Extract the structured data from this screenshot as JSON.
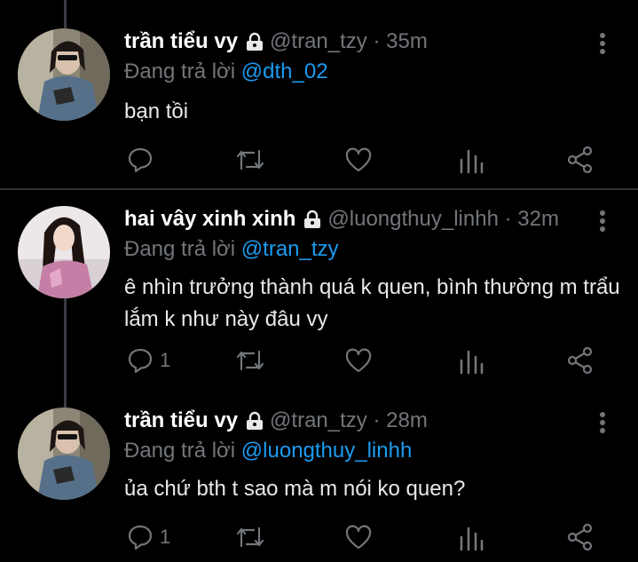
{
  "tweets": [
    {
      "name": "trần tiểu vy",
      "handle": "@tran_tzy",
      "sep": "·",
      "time": "35m",
      "reply_prefix": "Đang trả lời",
      "reply_to": "@dth_02",
      "text": "bạn tồi",
      "reply_count": ""
    },
    {
      "name": "hai vây xinh xinh",
      "handle": "@luongthuy_linhh",
      "sep": "·",
      "time": "32m",
      "reply_prefix": "Đang trả lời",
      "reply_to": "@tran_tzy",
      "text": "ê nhìn trưởng thành quá k quen, bình thường m trẩu lắm k như này đâu vy",
      "reply_count": "1"
    },
    {
      "name": "trần tiểu vy",
      "handle": "@tran_tzy",
      "sep": "·",
      "time": "28m",
      "reply_prefix": "Đang trả lời",
      "reply_to": "@luongthuy_linhh",
      "text": "ủa chứ bth t sao mà m nói ko quen?",
      "reply_count": "1"
    }
  ],
  "icons": [
    "lock-icon",
    "more-vertical-icon",
    "reply-icon",
    "retweet-icon",
    "like-icon",
    "analytics-icon",
    "share-icon"
  ],
  "colors": {
    "background": "#000000",
    "text": "#e7e9ea",
    "muted": "#72767b",
    "link": "#1d9bf0",
    "divider": "#2f3336"
  }
}
